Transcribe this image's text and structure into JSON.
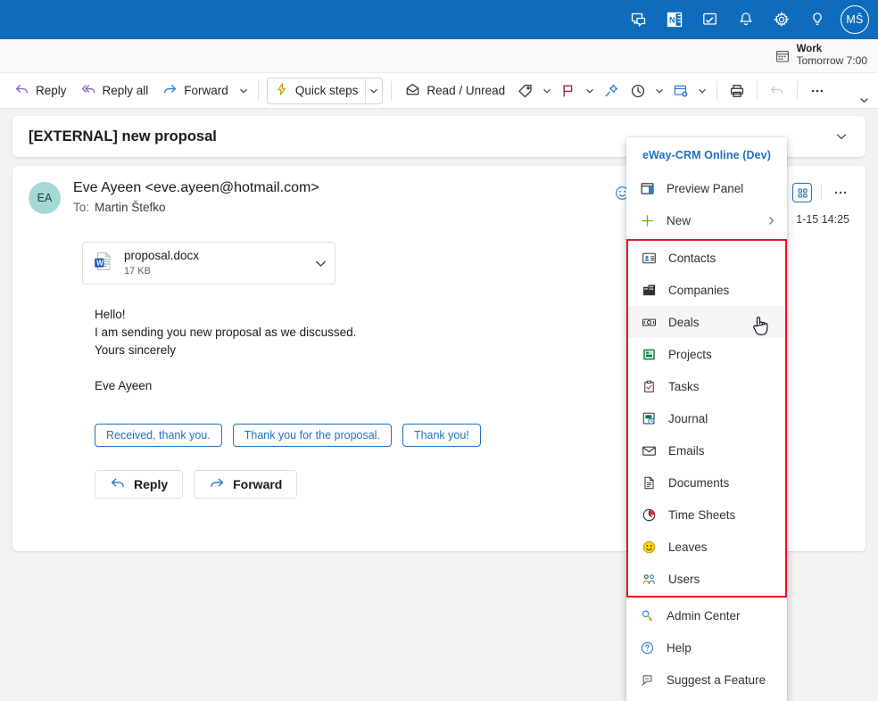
{
  "topbar": {
    "icons": [
      {
        "name": "teams-chat-icon",
        "label": "Chat"
      },
      {
        "name": "onenote-icon",
        "label": "OneNote"
      },
      {
        "name": "tasks-board-icon",
        "label": "To Do"
      },
      {
        "name": "bell-icon",
        "label": "Notifications"
      },
      {
        "name": "gear-icon",
        "label": "Settings"
      },
      {
        "name": "lightbulb-icon",
        "label": "Tips"
      }
    ],
    "avatar_initials": "MŠ"
  },
  "calendar_strip": {
    "icon": "calendar-icon",
    "title": "Work",
    "subtitle": "Tomorrow 7:00"
  },
  "toolbar": {
    "reply_label": "Reply",
    "reply_all_label": "Reply all",
    "forward_label": "Forward",
    "quick_steps_label": "Quick steps",
    "read_unread_label": "Read / Unread",
    "tag_label": "Categorize",
    "flag_label": "Flag",
    "pin_label": "Pin",
    "snooze_label": "Snooze",
    "rules_label": "Rules",
    "print_label": "Print",
    "undo_label": "Undo",
    "more_label": "More options",
    "expand_label": "Expand ribbon"
  },
  "subject": {
    "text": "[EXTERNAL] new proposal"
  },
  "message": {
    "avatar_initials": "EA",
    "from": "Eve Ayeen <eve.ayeen@hotmail.com>",
    "to_label": "To:",
    "to": "Martin Štefko",
    "timestamp": "1-15 14:25",
    "reaction_icon": "smiley-icon",
    "eway_icon": "eway-grid-icon",
    "more_icon": "more-dots-icon",
    "attachment": {
      "name": "proposal.docx",
      "size": "17 KB",
      "icon": "word-doc-icon"
    },
    "body_lines": [
      "Hello!",
      "I am sending you new proposal as we discussed.",
      "Yours sincerely"
    ],
    "signature": "Eve Ayeen",
    "suggestions": [
      "Received, thank you.",
      "Thank you for the proposal.",
      "Thank you!"
    ],
    "actions": [
      {
        "label": "Reply",
        "icon": "reply-icon"
      },
      {
        "label": "Forward",
        "icon": "forward-icon"
      }
    ]
  },
  "eway_menu": {
    "title": "eWay-CRM Online (Dev)",
    "top_items": [
      {
        "label": "Preview Panel",
        "icon": "preview-panel-icon",
        "arrow": false
      },
      {
        "label": "New",
        "icon": "plus-icon",
        "arrow": true
      }
    ],
    "modules": [
      {
        "label": "Contacts",
        "icon": "contacts-icon",
        "selected": false
      },
      {
        "label": "Companies",
        "icon": "companies-icon",
        "selected": false
      },
      {
        "label": "Deals",
        "icon": "deals-icon",
        "selected": true
      },
      {
        "label": "Projects",
        "icon": "projects-icon",
        "selected": false
      },
      {
        "label": "Tasks",
        "icon": "tasks-icon",
        "selected": false
      },
      {
        "label": "Journal",
        "icon": "journal-icon",
        "selected": false
      },
      {
        "label": "Emails",
        "icon": "emails-icon",
        "selected": false
      },
      {
        "label": "Documents",
        "icon": "documents-icon",
        "selected": false
      },
      {
        "label": "Time Sheets",
        "icon": "time-sheets-icon",
        "selected": false
      },
      {
        "label": "Leaves",
        "icon": "leaves-icon",
        "selected": false
      },
      {
        "label": "Users",
        "icon": "users-icon",
        "selected": false
      }
    ],
    "bottom_items": [
      {
        "label": "Admin Center",
        "icon": "admin-center-icon"
      },
      {
        "label": "Help",
        "icon": "help-icon"
      },
      {
        "label": "Suggest a Feature",
        "icon": "suggest-feature-icon"
      }
    ],
    "highlight_color": "#e81123",
    "accent_color": "#1f6fc4"
  }
}
